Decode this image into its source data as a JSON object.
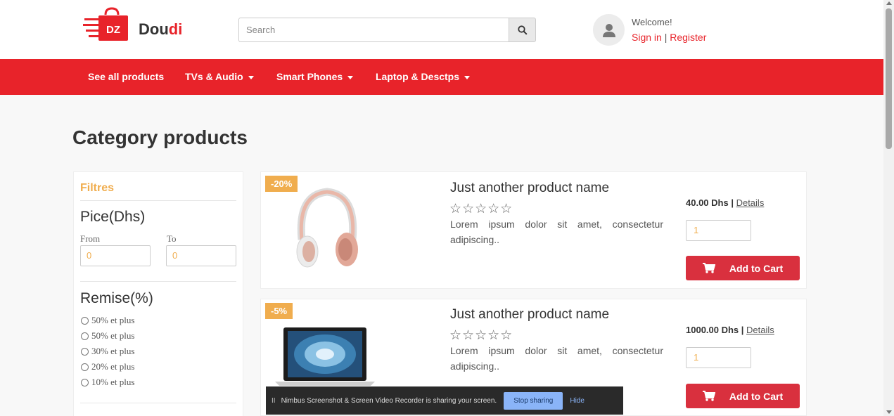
{
  "brand": {
    "name_main": "Dou",
    "name_accent": "di",
    "logo_text": "DZ"
  },
  "search": {
    "placeholder": "Search"
  },
  "user": {
    "welcome": "Welcome!",
    "sign_in": "Sign in",
    "separator": "|",
    "register": "Register"
  },
  "nav": {
    "items": [
      {
        "label": "See all products",
        "dropdown": false
      },
      {
        "label": "TVs & Audio",
        "dropdown": true
      },
      {
        "label": "Smart Phones",
        "dropdown": true
      },
      {
        "label": "Laptop & Desctps",
        "dropdown": true
      }
    ]
  },
  "page": {
    "title": "Category products"
  },
  "filters": {
    "title": "Filtres",
    "price_heading": "Pice(Dhs)",
    "from_label": "From",
    "to_label": "To",
    "from_value": "0",
    "to_value": "0",
    "discount_heading": "Remise(%)",
    "discount_options": [
      "50% et plus",
      "50% et plus",
      "30% et plus",
      "20% et plus",
      "10% et plus"
    ]
  },
  "products": [
    {
      "badge": "-20%",
      "name": "Just another product name",
      "stars": "☆☆☆☆☆",
      "description": "Lorem ipsum dolor sit amet, consectetur adipiscing..",
      "price": "40.00 Dhs",
      "details": "Details",
      "quantity": "1",
      "cart_label": "Add to Cart"
    },
    {
      "badge": "-5%",
      "name": "Just another product name",
      "stars": "☆☆☆☆☆",
      "description": "Lorem ipsum dolor sit amet, consectetur adipiscing..",
      "price": "1000.00 Dhs",
      "details": "Details",
      "quantity": "1",
      "cart_label": "Add to Cart"
    }
  ],
  "sharing_banner": {
    "pause": "II",
    "message": "Nimbus Screenshot & Screen Video Recorder is sharing your screen.",
    "stop_label": "Stop sharing",
    "hide_label": "Hide"
  },
  "colors": {
    "brand_red": "#e8232a",
    "cart_red": "#d9303e",
    "accent_orange": "#f0ad4e"
  }
}
